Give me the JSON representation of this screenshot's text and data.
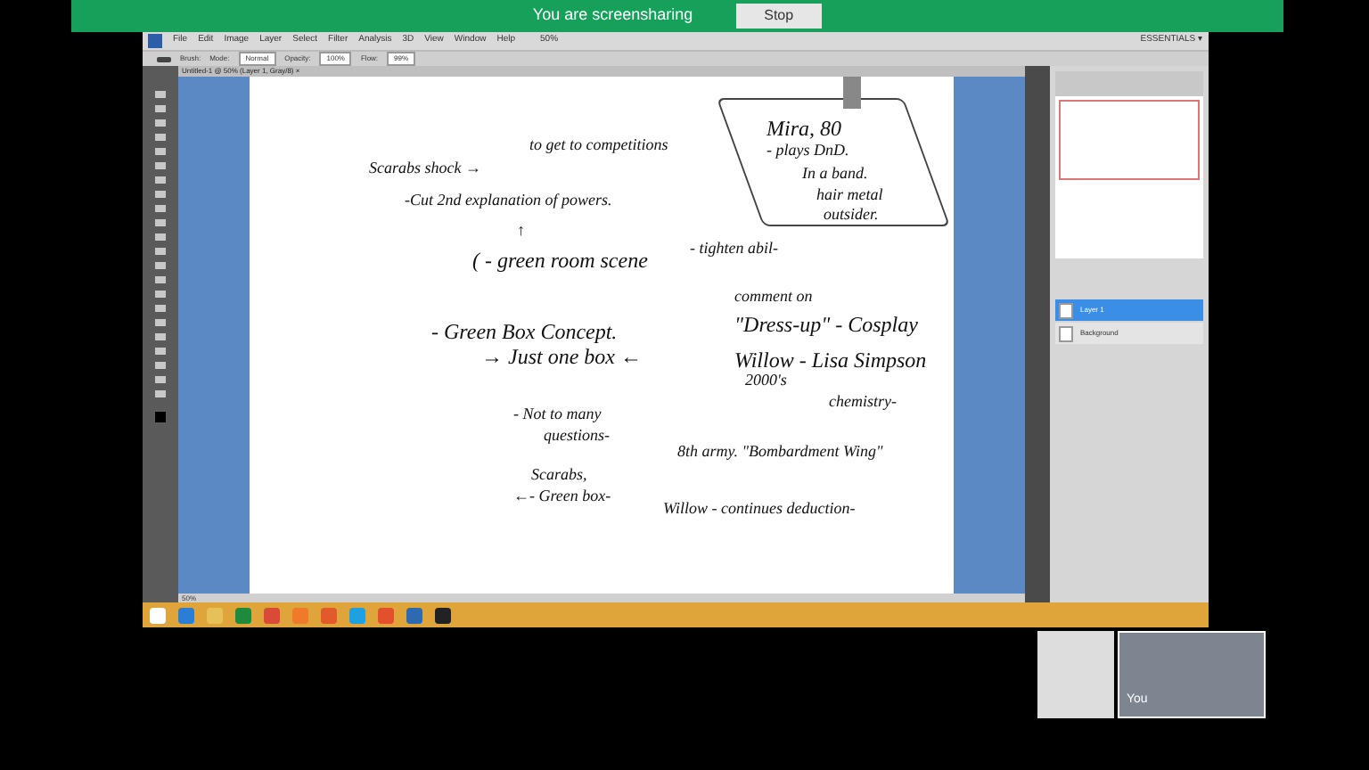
{
  "share_bar": {
    "message": "You are screensharing",
    "button": "Stop"
  },
  "app": {
    "menu": [
      "File",
      "Edit",
      "Image",
      "Layer",
      "Select",
      "Filter",
      "Analysis",
      "3D",
      "View",
      "Window",
      "Help"
    ],
    "workspace": "ESSENTIALS ▾",
    "zoom": "50%",
    "options": [
      "Brush:",
      "Mode:",
      "Normal",
      "Opacity:",
      "100%",
      "Flow:",
      "99%"
    ],
    "document_tab": "Untitled-1 @ 50% (Layer 1, Gray/8) ×",
    "notes": [
      {
        "text": "Mira, 80"
      },
      {
        "text": "to get to competitions"
      },
      {
        "text": "- plays DnD."
      },
      {
        "text": "Scarabs shock →"
      },
      {
        "text": "In a band."
      },
      {
        "text": "-Cut 2nd explanation of powers."
      },
      {
        "text": "hair metal"
      },
      {
        "text": "outsider."
      },
      {
        "text": "↑"
      },
      {
        "text": "( - green room scene"
      },
      {
        "text": "- tighten abil-"
      },
      {
        "text": "comment on"
      },
      {
        "text": "- Green Box Concept."
      },
      {
        "text": "\"Dress-up\" - Cosplay"
      },
      {
        "text": "→ Just one box ←"
      },
      {
        "text": "Willow - Lisa Simpson"
      },
      {
        "text": "2000's"
      },
      {
        "text": "- Not to many"
      },
      {
        "text": "chemistry-"
      },
      {
        "text": "questions-"
      },
      {
        "text": "8th army. \"Bombardment Wing\""
      },
      {
        "text": "Scarabs,"
      },
      {
        "text": "←- Green box-"
      },
      {
        "text": "Willow - continues deduction-"
      }
    ],
    "layers": [
      {
        "name": "Layer 1",
        "selected": true
      },
      {
        "name": "Background",
        "selected": false
      }
    ],
    "status": "50%"
  },
  "self_view": {
    "label": "You"
  }
}
